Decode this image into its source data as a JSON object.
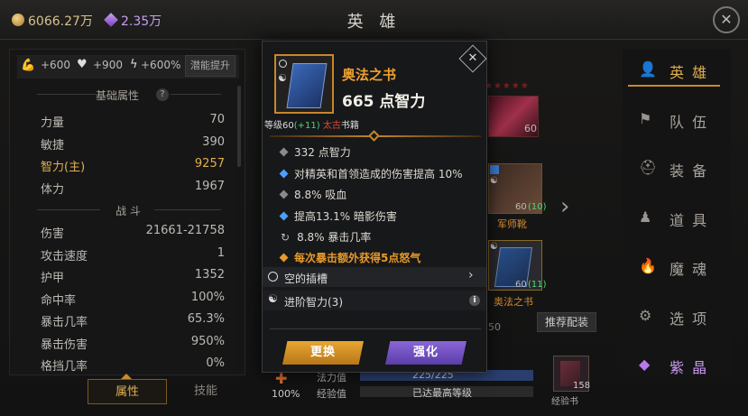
{
  "header": {
    "gold": "6066.27万",
    "gems": "2.35万",
    "title": "英 雄"
  },
  "bonuses": {
    "strength": "+600",
    "hp": "+900",
    "power": "+600%",
    "potential_button": "潜能提升"
  },
  "stats": {
    "section_basic": "基础属性",
    "help": "?",
    "basic": [
      {
        "label": "力量",
        "value": "70"
      },
      {
        "label": "敏捷",
        "value": "390"
      },
      {
        "label": "智力(主)",
        "value": "9257"
      },
      {
        "label": "体力",
        "value": "1967"
      }
    ],
    "section_combat": "战 斗",
    "combat": [
      {
        "label": "伤害",
        "value": "21661-21758"
      },
      {
        "label": "攻击速度",
        "value": "1"
      },
      {
        "label": "护甲",
        "value": "1352"
      },
      {
        "label": "命中率",
        "value": "100%"
      },
      {
        "label": "暴击几率",
        "value": "65.3%"
      },
      {
        "label": "暴击伤害",
        "value": "950%"
      },
      {
        "label": "格挡几率",
        "value": "0%"
      }
    ]
  },
  "bottom_tabs": {
    "attributes": "属性",
    "skills": "技能"
  },
  "nav": {
    "items": [
      "英 雄",
      "队 伍",
      "装 备",
      "道 具",
      "魔 魂",
      "选 项",
      "紫 晶"
    ]
  },
  "hero": {
    "equip_level_1": "60",
    "boots_level": "60",
    "boots_plus": "(10)",
    "boots_name": "军师靴",
    "book_level": "60",
    "book_plus": "(11)",
    "book_name": "奥法之书",
    "partial_num": "50",
    "recommend_button": "推荐配装",
    "percent": "100%",
    "mana_label": "法力值",
    "mana_value": "225/225",
    "exp_label": "经验值",
    "exp_value": "已达最高等级",
    "exp_book_count": "158",
    "exp_book_name": "经验书"
  },
  "popup": {
    "item_name": "奥法之书",
    "main_stat": "665 点智力",
    "level_prefix": "等级60",
    "level_plus": "(+11)",
    "quality": "太古",
    "type": "书籍",
    "stats": [
      {
        "text": "332 点智力",
        "kind": "gray"
      },
      {
        "text": "对精英和首领造成的伤害提高 10%",
        "kind": "blue"
      },
      {
        "text": "8.8% 吸血",
        "kind": "gray"
      },
      {
        "text": "提高13.1% 暗影伤害",
        "kind": "blue"
      },
      {
        "text": "8.8% 暴击几率",
        "kind": "reroll"
      }
    ],
    "legendary": "每次暴击额外获得5点怒气",
    "socket": "空的插槽",
    "advance": "进阶智力(3)",
    "replace_button": "更换",
    "upgrade_button": "强化"
  },
  "colors": {
    "orange": "#f0a030",
    "green": "#4fd67a",
    "red": "#e0483a",
    "blue": "#55a8ff",
    "purple_button": "#6f4fc4",
    "gold_button": "#d8961e"
  }
}
